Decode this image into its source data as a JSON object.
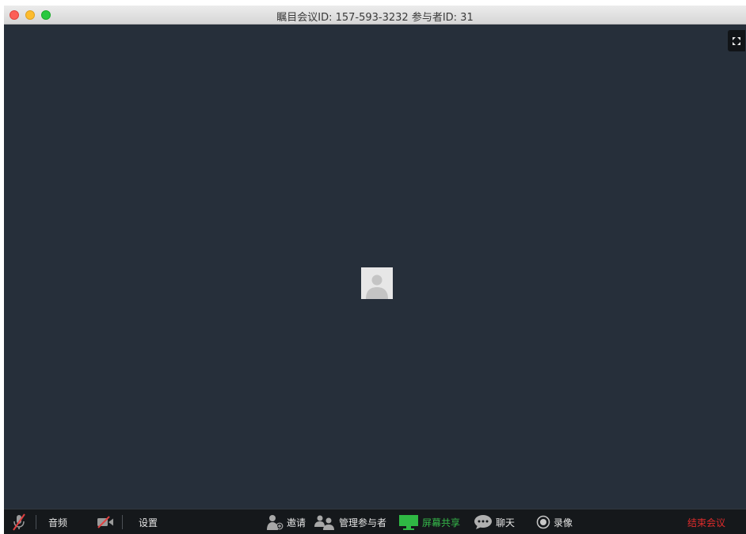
{
  "window": {
    "title": "瞩目会议ID: 157-593-3232 参与者ID: 31"
  },
  "icons": {
    "fullscreen": "fullscreen-icon",
    "avatar": "person-icon"
  },
  "toolbar": {
    "audio_label": "音频",
    "settings_label": "设置",
    "invite_label": "邀请",
    "manage_participants_label": "管理参与者",
    "screen_share_label": "屏幕共享",
    "chat_label": "聊天",
    "record_label": "录像",
    "end_meeting_label": "结束会议"
  },
  "colors": {
    "video_background": "#262f3a",
    "toolbar_background": "#15181b",
    "screen_share_accent": "#35b84a",
    "end_meeting_accent": "#e02b2b",
    "muted_accent": "#e24040"
  }
}
